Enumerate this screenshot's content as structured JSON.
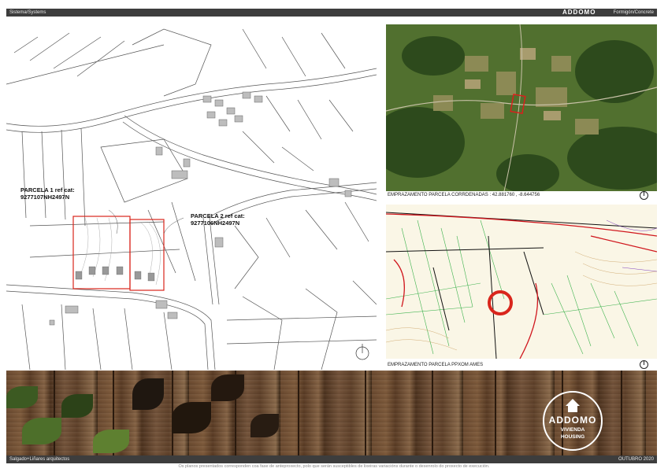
{
  "header": {
    "left_text": "Sistema/Systems",
    "logo_text": "ADDOMO",
    "right_text": "Formigón/Concrete"
  },
  "plan": {
    "parcel1_label": "PARCELA 1 ref cat:",
    "parcel1_ref": "9277107NH2497N",
    "parcel2_label": "PARCELA 2 ref cat:",
    "parcel2_ref": "9277106NH2497N"
  },
  "satellite": {
    "caption": "EMPRAZAMENTO PARCELA CORRDENADAS : 42.881760 , -8.644756"
  },
  "pgom": {
    "caption": "EMPRAZAMENTO PARCELA PPXOM AMES"
  },
  "badge": {
    "name": "ADDOMO",
    "line1": "VIVIENDA",
    "line2": "HOUSING"
  },
  "footer": {
    "left_text": "Salgado+Liñares arquitectos",
    "right_text": "OUTUBRO 2020",
    "note": "Os planos presentados corresponden coa fase de anteproxecto, polo que serán susceptibles de lixeiras variacións durante o desenrolo do proxecto de execución."
  },
  "colors": {
    "bar": "#3d3d3d",
    "parcel_outline": "#d9261c",
    "map_marker": "#d9261c"
  }
}
